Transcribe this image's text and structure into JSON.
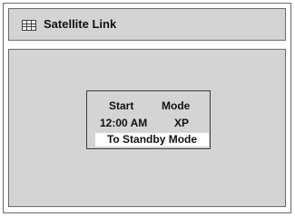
{
  "header": {
    "title": "Satellite Link",
    "icon": "menu-grid-icon"
  },
  "info": {
    "start_label": "Start",
    "mode_label": "Mode",
    "start_value": "12:00 AM",
    "mode_value": "XP"
  },
  "menu": {
    "selected_option": "To Standby Mode"
  },
  "colors": {
    "panel": "#d4d4d4",
    "border": "#6a6a6a",
    "highlight": "#ffffff"
  }
}
